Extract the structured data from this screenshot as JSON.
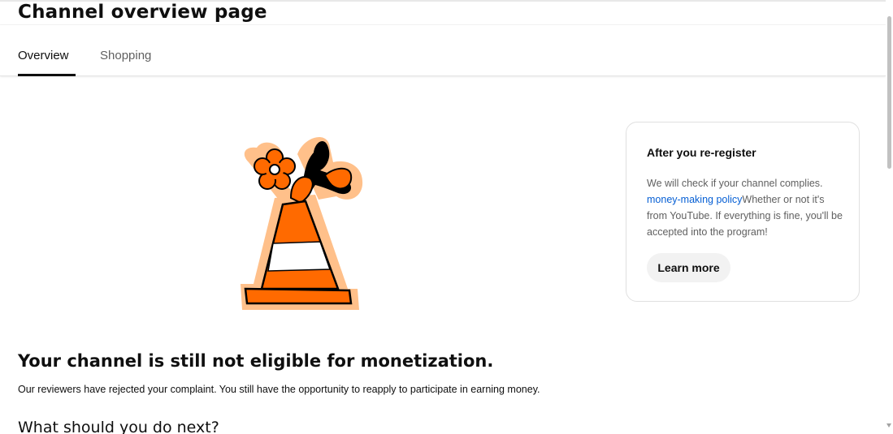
{
  "header": {
    "title": "Channel overview page"
  },
  "tabs": [
    {
      "label": "Overview",
      "active": true
    },
    {
      "label": "Shopping",
      "active": false
    }
  ],
  "illustration": {
    "icon": "traffic-cone-with-flowers-icon",
    "colors": {
      "orange": "#ff6a00",
      "peach": "#ffc08a",
      "outline": "#000000"
    }
  },
  "card": {
    "title": "After you re-register",
    "body_start": "We will check if your channel complies.",
    "link_text": "money-making policy",
    "body_end": "Whether or not it's from YouTube. If everything is fine, you'll be accepted into the program!",
    "button_label": "Learn more"
  },
  "main": {
    "headline": "Your channel is still not eligible for monetization.",
    "subtext": "Our reviewers have rejected your complaint. You still have the opportunity to reapply to participate in earning money.",
    "next_heading": "What should you do next?"
  },
  "colors": {
    "link": "#065fd4",
    "secondary_text": "#606060",
    "button_bg": "#f2f2f2"
  }
}
